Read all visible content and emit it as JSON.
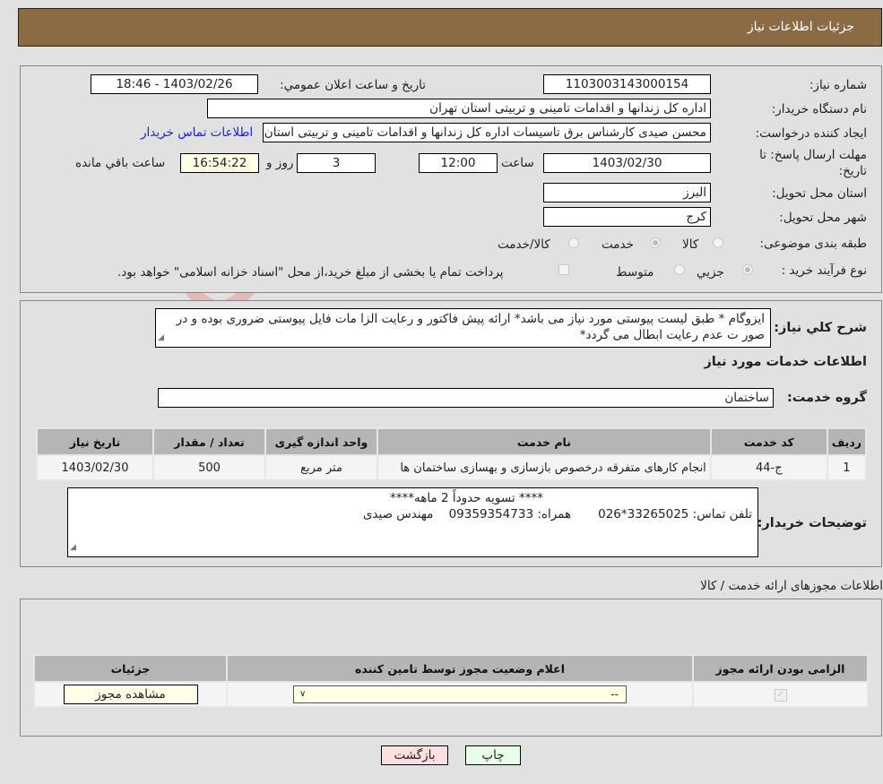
{
  "header": {
    "title": "جزئیات اطلاعات نیاز"
  },
  "form": {
    "need_number_label": "شماره نیاز:",
    "need_number": "1103003143000154",
    "announce_label": "تاریخ و ساعت اعلان عمومي:",
    "announce_value": "1403/02/26 - 18:46",
    "buyer_org_label": "نام دستگاه خريدار:",
    "buyer_org": "اداره کل زندانها و اقدامات تامینی و تربیتی استان تهران",
    "creator_label": "ایجاد کننده درخواست:",
    "creator": "محسن صیدی کارشناس برق تاسیسات  اداره کل زندانها و اقدامات تامینی و تربیتی استان تهران",
    "buyer_contact_link": "اطلاعات تماس خریدار",
    "deadline_label_1": "مهلت ارسال پاسخ: تا",
    "deadline_label_2": "تاریخ:",
    "deadline_date": "1403/02/30",
    "time_label": "ساعت",
    "deadline_time": "12:00",
    "days_value": "3",
    "days_label": "روز و",
    "remaining_time": "16:54:22",
    "remaining_label": "ساعت باقي مانده",
    "province_label": "استان محل تحویل:",
    "province": "البرز",
    "city_label": "شهر محل تحویل:",
    "city": "کرج",
    "category_label": "طبقه بندی موضوعی:",
    "category_options": [
      "کالا",
      "خدمت",
      "کالا/خدمت"
    ],
    "category_selected": "خدمت",
    "process_label": "نوع فرآیند خرید :",
    "process_options": [
      "جزيي",
      "متوسط"
    ],
    "process_selected": "جزيي",
    "treasury_note": "پرداخت تمام یا بخشی از مبلغ خرید،از محل \"اسناد خزانه اسلامی\" خواهد بود."
  },
  "description": {
    "label": "شرح کلي نياز:",
    "text": "ایزوگام * طبق لیست پیوستی مورد نیاز می باشد* ارائه پیش فاکتور و رعایت الزا مات فایل پیوستی ضروری بوده و در صور ت عدم رعایت ابطال می گردد*"
  },
  "services": {
    "section_title": "اطلاعات خدمات مورد نیاز",
    "group_label": "گروه خدمت:",
    "group_value": "ساختمان",
    "columns": [
      "ردیف",
      "کد خدمت",
      "نام خدمت",
      "واحد اندازه گیری",
      "تعداد / مقدار",
      "تاریخ نیاز"
    ],
    "rows": [
      {
        "row": "1",
        "code": "ج-44",
        "name": "انجام کارهای متفرقه درخصوص بازسازی و بهسازی ساختمان ها",
        "unit": "متر مربع",
        "qty": "500",
        "date": "1403/02/30"
      }
    ]
  },
  "buyer_notes": {
    "label": "توضیحات خریدار:",
    "line1": "**** تسویه حدوداً 2 ماهه****",
    "line2": "تلفن تماس: 33265025*026       همراه: 09359354733    مهندس صیدی"
  },
  "permits": {
    "section_title": "اطلاعات مجوزهای ارائه خدمت / کالا",
    "columns": [
      "الزامی بودن ارائه مجوز",
      "اعلام وضعیت مجوز توسط تامین کننده",
      "جزئیات"
    ],
    "rows": [
      {
        "required": true,
        "status_selected": "--",
        "details_button": "مشاهده مجوز"
      }
    ]
  },
  "buttons": {
    "print": "چاپ",
    "back": "بازگشت"
  },
  "colors": {
    "header_bg": "#8b6b43",
    "link": "#1a1aff",
    "back_btn": "#ffe0e0",
    "print_btn": "#e8ffe8"
  }
}
